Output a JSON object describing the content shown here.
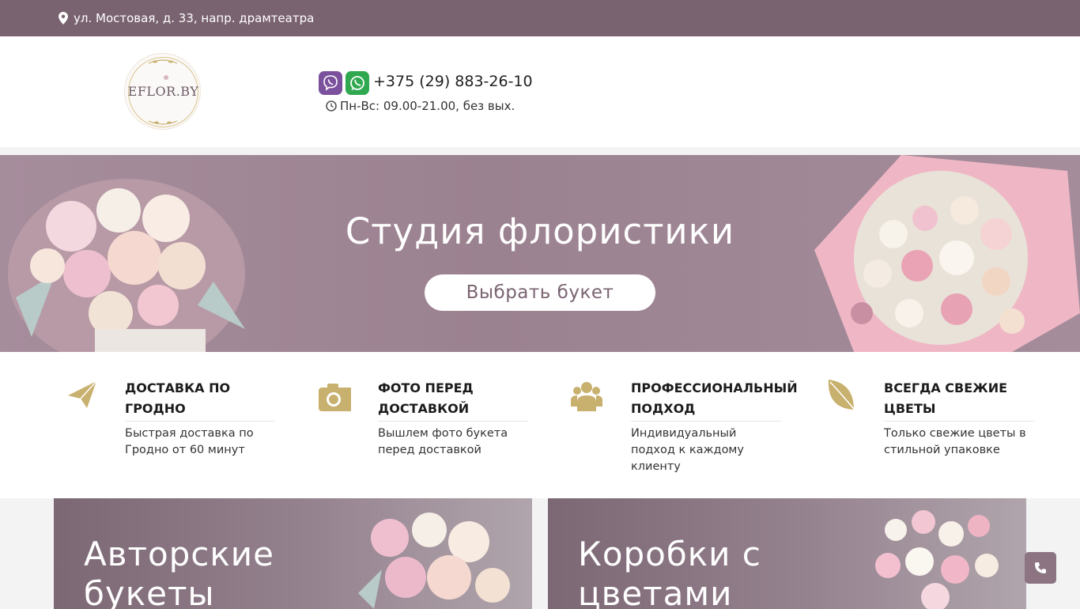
{
  "topbar": {
    "address": "ул. Мостовая, д. 33, напр. драмтеатра"
  },
  "header": {
    "logo_text": "EFLOR.BY",
    "phone": "+375 (29) 883-26-10",
    "hours": "Пн-Вс: 09.00-21.00, без вых."
  },
  "hero": {
    "title": "Студия флористики",
    "button_label": "Выбрать букет"
  },
  "features": [
    {
      "title": "ДОСТАВКА ПО ГРОДНО",
      "desc": "Быстрая доставка по Гродно от 60 минут",
      "icon": "paper-plane-icon"
    },
    {
      "title": "ФОТО ПЕРЕД ДОСТАВКОЙ",
      "desc": "Вышлем фото букета перед доставкой",
      "icon": "camera-icon"
    },
    {
      "title": "ПРОФЕССИОНАЛЬНЫЙ ПОДХОД",
      "desc": "Индивидуальный подход к каждому клиенту",
      "icon": "users-icon"
    },
    {
      "title": "ВСЕГДА СВЕЖИЕ ЦВЕТЫ",
      "desc": "Только свежие цветы в стильной упаковке",
      "icon": "leaf-icon"
    }
  ],
  "cards": [
    {
      "title": "Авторские букеты"
    },
    {
      "title": "Коробки с цветами"
    }
  ],
  "colors": {
    "topbar": "#7a6370",
    "hero": "#9b8290",
    "accent_gold": "#c8b06e",
    "viber": "#7b519d",
    "whatsapp": "#2fa84f",
    "call_button": "#8c7483"
  }
}
